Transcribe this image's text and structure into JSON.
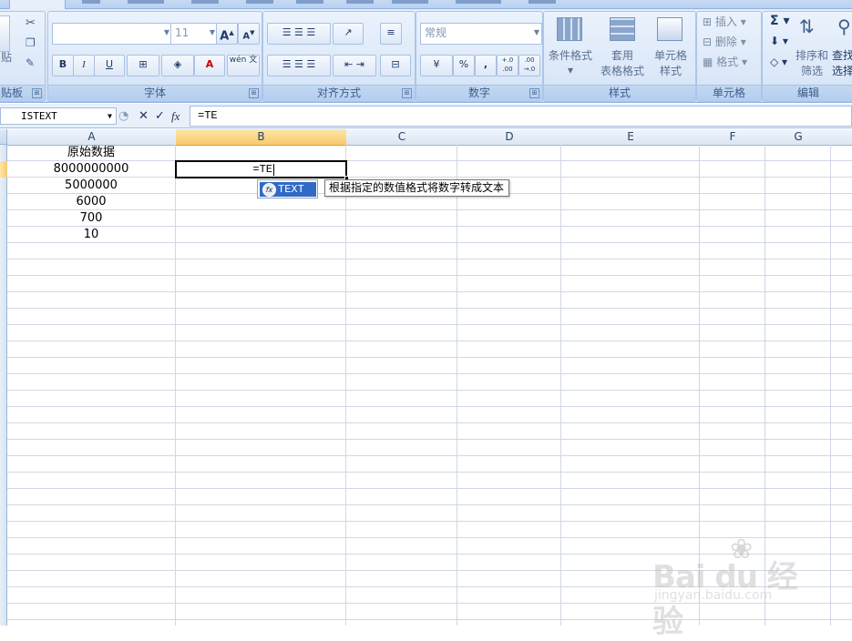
{
  "ribbon": {
    "clipboard": {
      "label": "贴板",
      "paste_label": "贴",
      "launcher": "⊞"
    },
    "font": {
      "label": "字体",
      "font_name": "",
      "font_size": "11",
      "grow_label": "A",
      "shrink_label": "A",
      "bold_label": "B",
      "italic_label": "I",
      "underline_label": "U",
      "phonetic_label": "wén 文",
      "color_label": "A"
    },
    "alignment": {
      "label": "对齐方式"
    },
    "number": {
      "label": "数字",
      "format": "常规",
      "percent_label": "%",
      "comma_label": ",",
      "inc_decimal": "+.0 .00",
      "dec_decimal": ".00 →.0"
    },
    "styles": {
      "label": "样式",
      "conditional": "条件格式",
      "table_line1": "套用",
      "table_line2": "表格格式",
      "cell_line1": "单元格",
      "cell_line2": "样式"
    },
    "cells": {
      "label": "单元格",
      "insert": "插入",
      "delete": "删除",
      "format": "格式"
    },
    "editing": {
      "label": "编辑",
      "sigma": "Σ",
      "sort_line1": "排序和",
      "sort_line2": "筛选",
      "find_line1": "查找",
      "find_line2": "选择"
    }
  },
  "formula_bar": {
    "name_box": "ISTEXT",
    "cancel": "✕",
    "enter": "✓",
    "fx": "fx",
    "content": "=TE"
  },
  "columns": [
    "A",
    "B",
    "C",
    "D",
    "E",
    "F",
    "G"
  ],
  "cells": {
    "a1": "原始数据",
    "a2": "8000000000",
    "a3": "5000000",
    "a4": "6000",
    "a5": "700",
    "a6": "10",
    "b2_edit": "=TE"
  },
  "autocomplete": {
    "item": "TEXT",
    "icon": "fx",
    "tooltip": "根据指定的数值格式将数字转成文本"
  },
  "watermark": {
    "brand": "Bai du 经验",
    "url": "jingyan.baidu.com"
  },
  "colors": {
    "accent": "#316ac5",
    "header_selected": "#f8c96d",
    "gridline": "#d0d7e5",
    "ribbon_text": "#15428b"
  }
}
